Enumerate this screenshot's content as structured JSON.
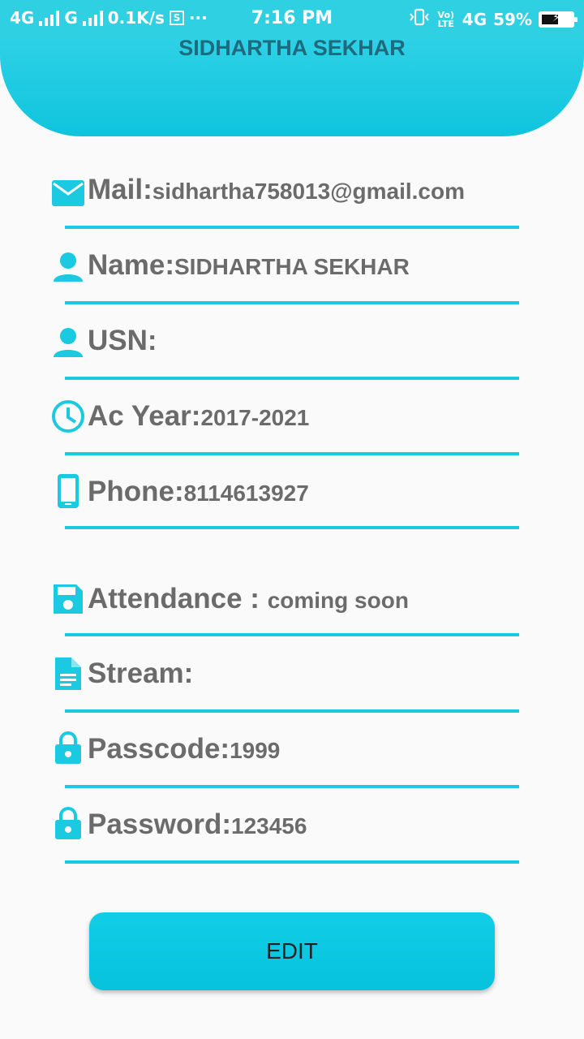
{
  "status_bar": {
    "network_left": "4G",
    "network_right": "G",
    "speed": "0.1K/s",
    "more": "···",
    "time": "7:16 PM",
    "volte": "Vo) LTE",
    "network_4g": "4G",
    "battery_percent": "59%",
    "battery_level": 0.59
  },
  "header": {
    "name": "SIDHARTHA SEKHAR"
  },
  "fields": [
    {
      "label": "Mail:",
      "value": "sidhartha758013@gmail.com",
      "icon": "mail-icon"
    },
    {
      "label": "Name:",
      "value": "SIDHARTHA SEKHAR",
      "icon": "person-icon"
    },
    {
      "label": "USN:",
      "value": "",
      "icon": "person-icon"
    },
    {
      "label": "Ac Year:",
      "value": "2017-2021",
      "icon": "clock-icon"
    },
    {
      "label": "Phone:",
      "value": "8114613927",
      "icon": "phone-icon"
    },
    {
      "label": "Attendance : ",
      "value": "coming soon",
      "icon": "save-icon"
    },
    {
      "label": "Stream:",
      "value": "",
      "icon": "document-icon"
    },
    {
      "label": "Passcode:",
      "value": "1999",
      "icon": "lock-icon"
    },
    {
      "label": "Password:",
      "value": "123456",
      "icon": "lock-icon"
    }
  ],
  "edit_button": {
    "label": "EDIT"
  },
  "colors": {
    "accent": "#1bc9e0",
    "header_text": "#1f6a7c",
    "label_text": "#6b6b6b"
  }
}
